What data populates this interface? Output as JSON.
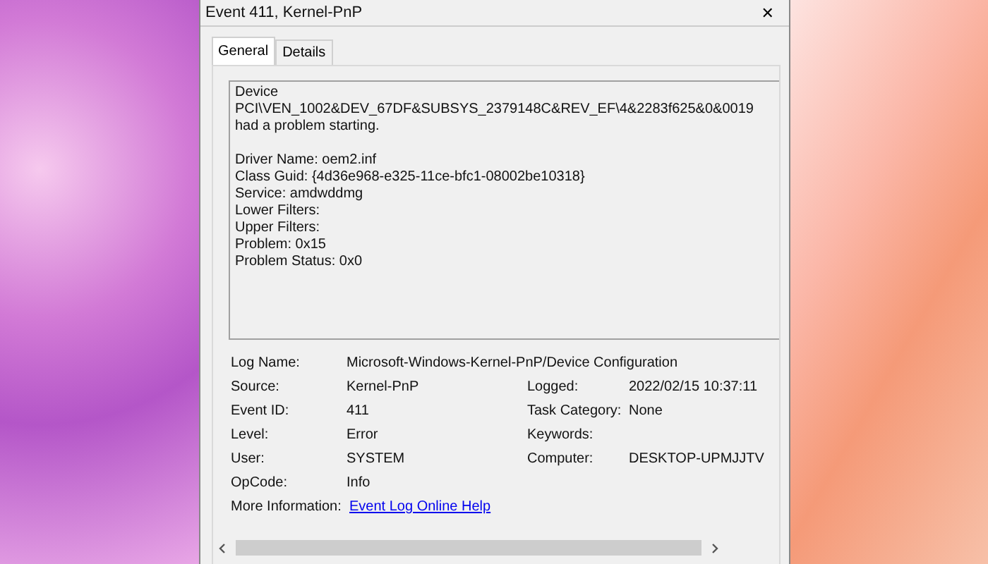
{
  "window": {
    "title": "Event 411, Kernel-PnP",
    "close": "✕"
  },
  "tabs": [
    {
      "label": "General",
      "selected": true
    },
    {
      "label": "Details",
      "selected": false
    }
  ],
  "description": {
    "message": "Device PCI\\VEN_1002&DEV_67DF&SUBSYS_2379148C&REV_EF\\4&2283f625&0&0019 had a problem starting.",
    "lines": [
      "Driver Name: oem2.inf",
      "Class Guid: {4d36e968-e325-11ce-bfc1-08002be10318}",
      "Service: amdwddmg",
      "Lower Filters:",
      "Upper Filters:",
      "Problem: 0x15",
      "Problem Status: 0x0"
    ]
  },
  "properties": [
    {
      "label": "Log Name:",
      "value": "Microsoft-Windows-Kernel-PnP/Device Configuration"
    },
    {
      "label": "Source:",
      "value": "Kernel-PnP",
      "right_label": "Logged:",
      "right_value": "2022/02/15 10:37:11"
    },
    {
      "label": "Event ID:",
      "value": "411",
      "right_label": "Task Category:",
      "right_value": "None"
    },
    {
      "label": "Level:",
      "value": "Error",
      "right_label": "Keywords:"
    },
    {
      "label": "User:",
      "value": "SYSTEM",
      "right_label": "Computer:",
      "right_value": "DESKTOP-UPMJJTV"
    },
    {
      "label": "OpCode:",
      "value": "Info"
    },
    {
      "label": "More Information:",
      "link": "Event Log Online Help"
    }
  ]
}
